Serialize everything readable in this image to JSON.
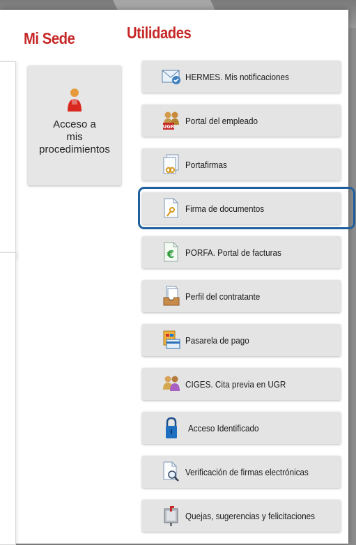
{
  "mi_sede": {
    "heading": "Mi Sede",
    "tile": {
      "line1": "Acceso a",
      "line2": "mis",
      "line3": "procedimientos",
      "icon": "user-icon"
    }
  },
  "utilidades": {
    "heading": "Utilidades",
    "items": [
      {
        "label": "HERMES. Mis notificaciones",
        "icon": "mail-check-icon"
      },
      {
        "label": "Portal del empleado",
        "icon": "employees-icon"
      },
      {
        "label": "Portafirmas",
        "icon": "signature-docs-icon"
      },
      {
        "label": "Firma de documentos",
        "icon": "document-pen-icon"
      },
      {
        "label": "PORFA. Portal de facturas",
        "icon": "euro-document-icon"
      },
      {
        "label": "Perfil del contratante",
        "icon": "inbox-tray-icon"
      },
      {
        "label": "Pasarela de pago",
        "icon": "payment-card-icon"
      },
      {
        "label": "CIGES. Cita previa en UGR",
        "icon": "people-appointment-icon"
      },
      {
        "label": "Acceso Identificado",
        "icon": "padlock-icon"
      },
      {
        "label": "Verificación de firmas electrónicas",
        "icon": "document-magnifier-icon"
      },
      {
        "label": "Quejas, sugerencias y felicitaciones",
        "icon": "mailbox-icon"
      }
    ],
    "highlighted_index": 3
  },
  "colors": {
    "heading": "#c62828",
    "highlight_border": "#1f5f9e",
    "button_bg": "#e4e4e4"
  }
}
